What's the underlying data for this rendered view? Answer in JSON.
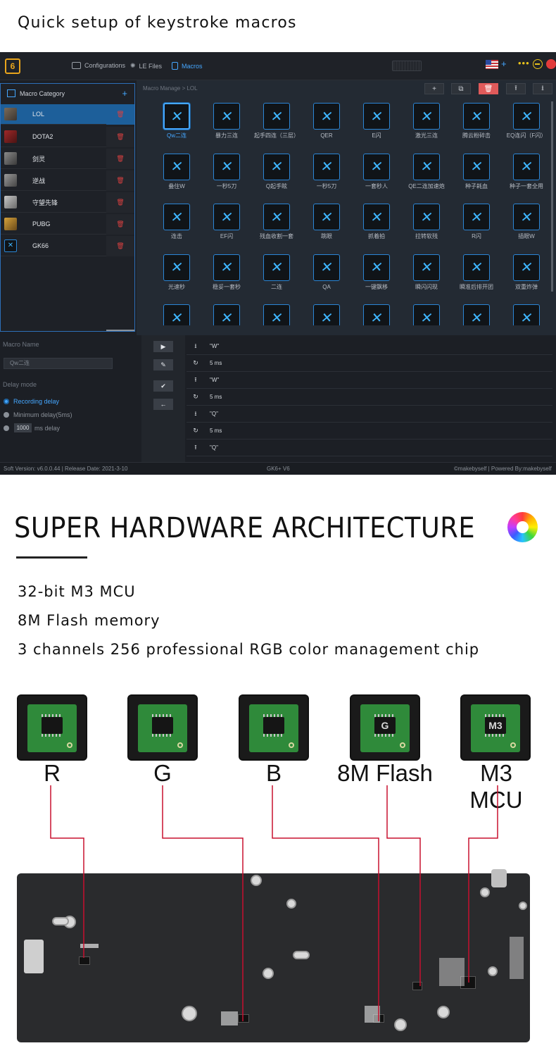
{
  "page": {
    "heading": "Quick setup of keystroke macros"
  },
  "app": {
    "logo_text": "6",
    "nav": {
      "configurations": "Configurations",
      "le_files": "LE Files",
      "macros": "Macros"
    },
    "sidebar": {
      "title": "Macro Category",
      "add": "+",
      "items": [
        {
          "label": "LOL"
        },
        {
          "label": "DOTA2"
        },
        {
          "label": "剑灵"
        },
        {
          "label": "逆战"
        },
        {
          "label": "守望先锋"
        },
        {
          "label": "PUBG"
        },
        {
          "label": "GK66"
        }
      ]
    },
    "main": {
      "breadcrumb": "Macro Manage  >  LOL",
      "macros": [
        "Qw二连",
        "暴力三连",
        "起手四连（三层）",
        "QER",
        "E闪",
        "激光三连",
        "腾云粉碎击",
        "EQ连闪（F闪）",
        "叠住W",
        "一秒5刀",
        "Q起手眩",
        "一秒5刀",
        "一套秒人",
        "QE二连加速炮",
        "种子耗血",
        "种子一套全用",
        "连击",
        "EF闪",
        "残血收割一套",
        "跳眼",
        "抓着拍",
        "拉转软残",
        "R闪",
        "插眼W",
        "光速秒",
        "稳妥一套秒",
        "二连",
        "QA",
        "一键飘移",
        "瞬闪闪现",
        "瞬准后排开团",
        "双重炸弹",
        "",
        "",
        "",
        "",
        "",
        "",
        "",
        ""
      ]
    },
    "editor": {
      "macro_name_label": "Macro Name",
      "macro_name_value": "Qw二连",
      "delay_mode_label": "Delay mode",
      "option_recording": "Recording delay",
      "option_minimum": "Minimum delay(5ms)",
      "custom_delay_value": "1000",
      "custom_delay_unit": "ms delay",
      "steps": [
        {
          "type": "down",
          "text": "\"W\""
        },
        {
          "type": "delay",
          "text": "5 ms"
        },
        {
          "type": "up",
          "text": "\"W\""
        },
        {
          "type": "delay",
          "text": "5 ms"
        },
        {
          "type": "down",
          "text": "\"Q\""
        },
        {
          "type": "delay",
          "text": "5 ms"
        },
        {
          "type": "up",
          "text": "\"Q\""
        }
      ]
    },
    "status": {
      "version": "Soft Version: v6.0.0.44  |  Release Date: 2021-3-10",
      "product": "GK6+ V6",
      "credit": "©makebyself  |  Powered By:makebyself"
    }
  },
  "hardware": {
    "title": "SUPER HARDWARE ARCHITECTURE",
    "specs": [
      "32-bit M3 MCU",
      "8M Flash memory",
      "3 channels 256 professional RGB color management chip"
    ],
    "chips": [
      {
        "label": "R",
        "mark": ""
      },
      {
        "label": "G",
        "mark": ""
      },
      {
        "label": "B",
        "mark": ""
      },
      {
        "label": "8M Flash",
        "mark": "G"
      },
      {
        "label": "M3 MCU",
        "mark": "M3"
      }
    ],
    "colors": {
      "wire": "#c8102e",
      "pcb": "#2f8a3a",
      "accent": "#45a7ff"
    }
  }
}
